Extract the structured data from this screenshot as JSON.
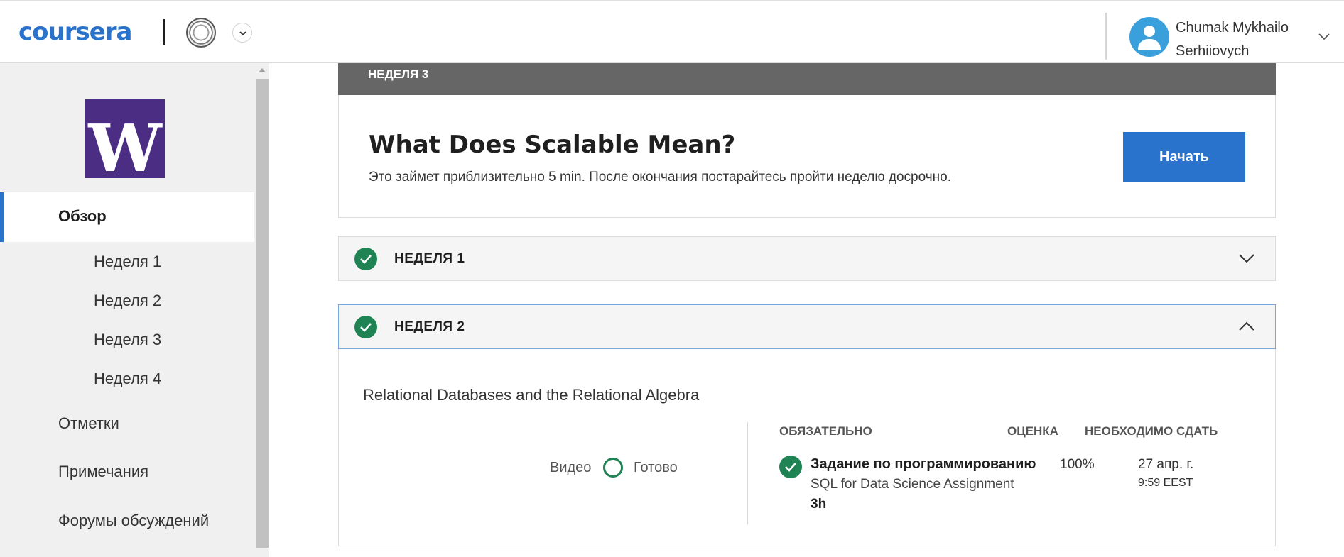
{
  "header": {
    "logo_text": "coursera",
    "brand_color": "#2a73cc",
    "user_name": "Chumak Mykhailo Serhiiovych"
  },
  "sidebar": {
    "course_logo_letter": "W",
    "course_logo_color": "#4b2e83",
    "items": [
      {
        "label": "Обзор",
        "active": true
      },
      {
        "label": "Неделя 1"
      },
      {
        "label": "Неделя 2"
      },
      {
        "label": "Неделя 3"
      },
      {
        "label": "Неделя 4"
      },
      {
        "label": "Отметки"
      },
      {
        "label": "Примечания"
      },
      {
        "label": "Форумы обсуждений"
      }
    ]
  },
  "main": {
    "current_week_label": "НЕДЕЛЯ 3",
    "hero": {
      "title": "What Does Scalable Mean?",
      "description": "Это займет приблизительно 5 min. После окончания постарайтесь пройти неделю досрочно.",
      "start_button": "Начать"
    },
    "weeks": [
      {
        "label": "НЕДЕЛЯ 1",
        "completed": true,
        "expanded": false
      },
      {
        "label": "НЕДЕЛЯ 2",
        "completed": true,
        "expanded": true
      }
    ],
    "week2_detail": {
      "module_title": "Relational Databases and the Relational Algebra",
      "video_label": "Видео",
      "done_label": "Готово",
      "columns": {
        "required": "ОБЯЗАТЕЛЬНО",
        "grade": "ОЦЕНКА",
        "due": "НЕОБХОДИМО СДАТЬ"
      },
      "task": {
        "type": "Задание по программированию",
        "name": "SQL for Data Science Assignment",
        "duration": "3h",
        "grade": "100%",
        "due_date": "27 апр. г.",
        "due_time": "9:59 EEST"
      }
    }
  },
  "colors": {
    "success": "#1f8354",
    "banner": "#666666",
    "sidebar_bg": "#f0f0f0"
  }
}
